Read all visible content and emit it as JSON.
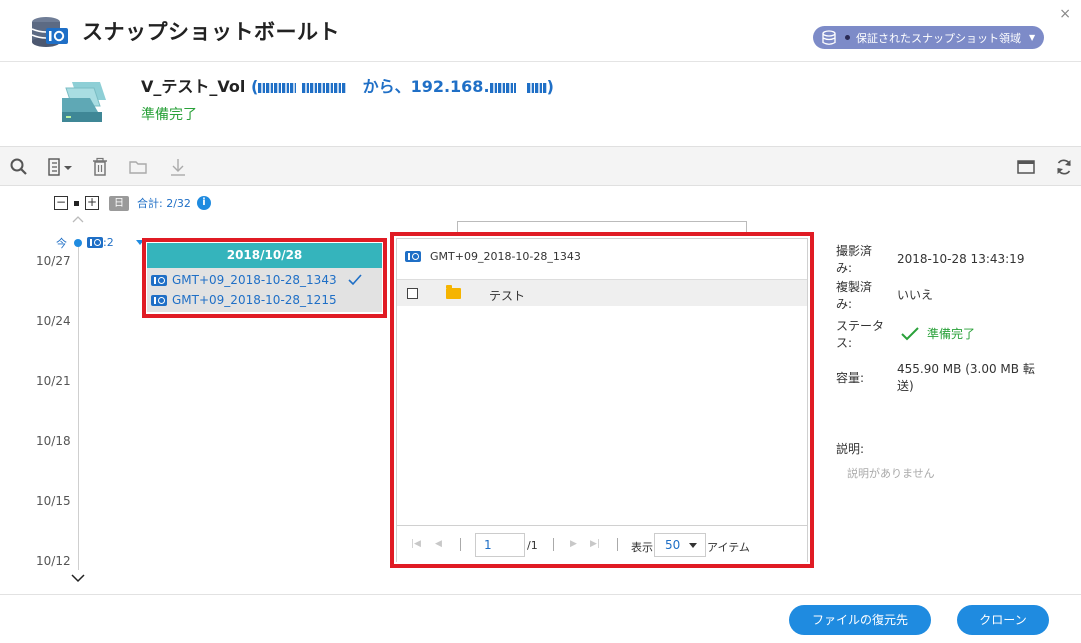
{
  "window": {
    "title": "スナップショットボールト",
    "close": "×",
    "vault_selector": "保証されたスナップショット領域"
  },
  "volume": {
    "name": "V_テスト_Vol",
    "paren_open": "(",
    "from_text": "から、192.168.",
    "paren_close": ")",
    "status": "準備完了"
  },
  "timeline": {
    "total": "合計: 2/32",
    "day_badge": "日",
    "info": "i",
    "now_label": "今",
    "snapshot_count": ":2",
    "dates": [
      "10/27",
      "10/24",
      "10/21",
      "10/18",
      "10/15",
      "10/12"
    ]
  },
  "snapshot_list": {
    "date": "2018/10/28",
    "items": [
      "GMT+09_2018-10-28_1343",
      "GMT+09_2018-10-28_1215"
    ]
  },
  "file_browser": {
    "title": "GMT+09_2018-10-28_1343",
    "rows": [
      {
        "name": "テスト"
      }
    ],
    "page": "1",
    "page_total": "/1",
    "show_label": "表示",
    "page_size": "50",
    "items_label": "アイテム"
  },
  "details": {
    "taken_label": "撮影済み:",
    "taken_value": "2018-10-28 13:43:19",
    "replicated_label": "複製済み:",
    "replicated_value": "いいえ",
    "status_label": "ステータス:",
    "status_value": "準備完了",
    "capacity_label": "容量:",
    "capacity_value": "455.90 MB (3.00 MB 転送)",
    "description_label": "説明:",
    "description_value": "説明がありません"
  },
  "footer": {
    "restore_button": "ファイルの復元先",
    "clone_button": "クローン"
  },
  "colors": {
    "accent": "#1f8be0",
    "teal_header": "#35b4bc",
    "ready_green": "#2aa13a",
    "highlight_red": "#e01b24",
    "vault_pill": "#7d8bc8"
  }
}
